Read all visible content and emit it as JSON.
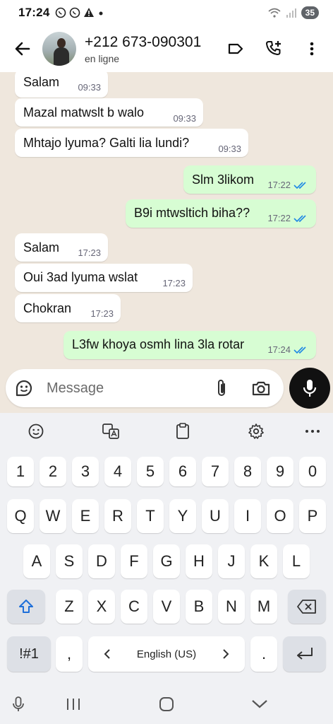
{
  "status_bar": {
    "time": "17:24",
    "battery": "35"
  },
  "header": {
    "contact_name": "+212 673-090301",
    "contact_status": "en ligne"
  },
  "messages": [
    {
      "dir": "in",
      "text": "Salam",
      "time": "09:33"
    },
    {
      "dir": "in",
      "text": "Mazal matwslt b walo",
      "time": "09:33"
    },
    {
      "dir": "in",
      "text": "Mhtajo lyuma? Galti lia lundi?",
      "time": "09:33"
    },
    {
      "dir": "out",
      "text": "Slm 3likom",
      "time": "17:22"
    },
    {
      "dir": "out",
      "text": "B9i mtwsltich biha??",
      "time": "17:22"
    },
    {
      "dir": "in",
      "text": "Salam",
      "time": "17:23"
    },
    {
      "dir": "in",
      "text": "Oui 3ad lyuma wslat",
      "time": "17:23"
    },
    {
      "dir": "in",
      "text": "Chokran",
      "time": "17:23"
    },
    {
      "dir": "out",
      "text": "L3fw khoya osmh lina 3la rotar",
      "time": "17:24"
    }
  ],
  "composer": {
    "placeholder": "Message"
  },
  "keyboard": {
    "numbers": [
      "1",
      "2",
      "3",
      "4",
      "5",
      "6",
      "7",
      "8",
      "9",
      "0"
    ],
    "row1": [
      "Q",
      "W",
      "E",
      "R",
      "T",
      "Y",
      "U",
      "I",
      "O",
      "P"
    ],
    "row2": [
      "A",
      "S",
      "D",
      "F",
      "G",
      "H",
      "J",
      "K",
      "L"
    ],
    "row3": [
      "Z",
      "X",
      "C",
      "V",
      "B",
      "N",
      "M"
    ],
    "symbols_key": "!#1",
    "comma_key": ",",
    "period_key": ".",
    "language": "English (US)"
  },
  "colors": {
    "incoming": "#ffffff",
    "outgoing": "#d7fdd3",
    "chat_bg": "#efe7dd",
    "read_ticks": "#1e88e5"
  }
}
